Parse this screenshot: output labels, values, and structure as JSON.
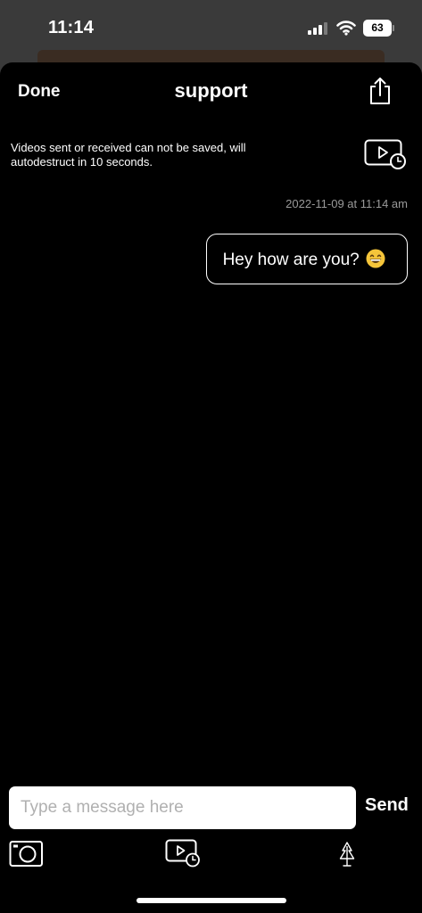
{
  "status_bar": {
    "time": "11:14",
    "battery_level": "63"
  },
  "header": {
    "done_label": "Done",
    "title": "support",
    "share_icon": "share-icon"
  },
  "notice": {
    "text": "Videos sent or received can not be saved, will\n autodestruct in 10 seconds.",
    "icon": "video-timer-icon"
  },
  "conversation": {
    "messages": [
      {
        "timestamp": "2022-11-09 at 11:14 am",
        "text": "Hey how are you?",
        "emoji": "grinning-face-emoji",
        "direction": "outgoing"
      }
    ]
  },
  "composer": {
    "placeholder": "Type a message here",
    "value": "",
    "send_label": "Send"
  },
  "toolbar": {
    "camera_icon": "camera-icon",
    "video_icon": "video-timer-icon",
    "tree_icon": "tree-icon"
  },
  "colors": {
    "background": "#000000",
    "text": "#ffffff",
    "timestamp": "#9a9a9a",
    "input_background": "#ffffff",
    "placeholder": "#b0b0b0"
  }
}
